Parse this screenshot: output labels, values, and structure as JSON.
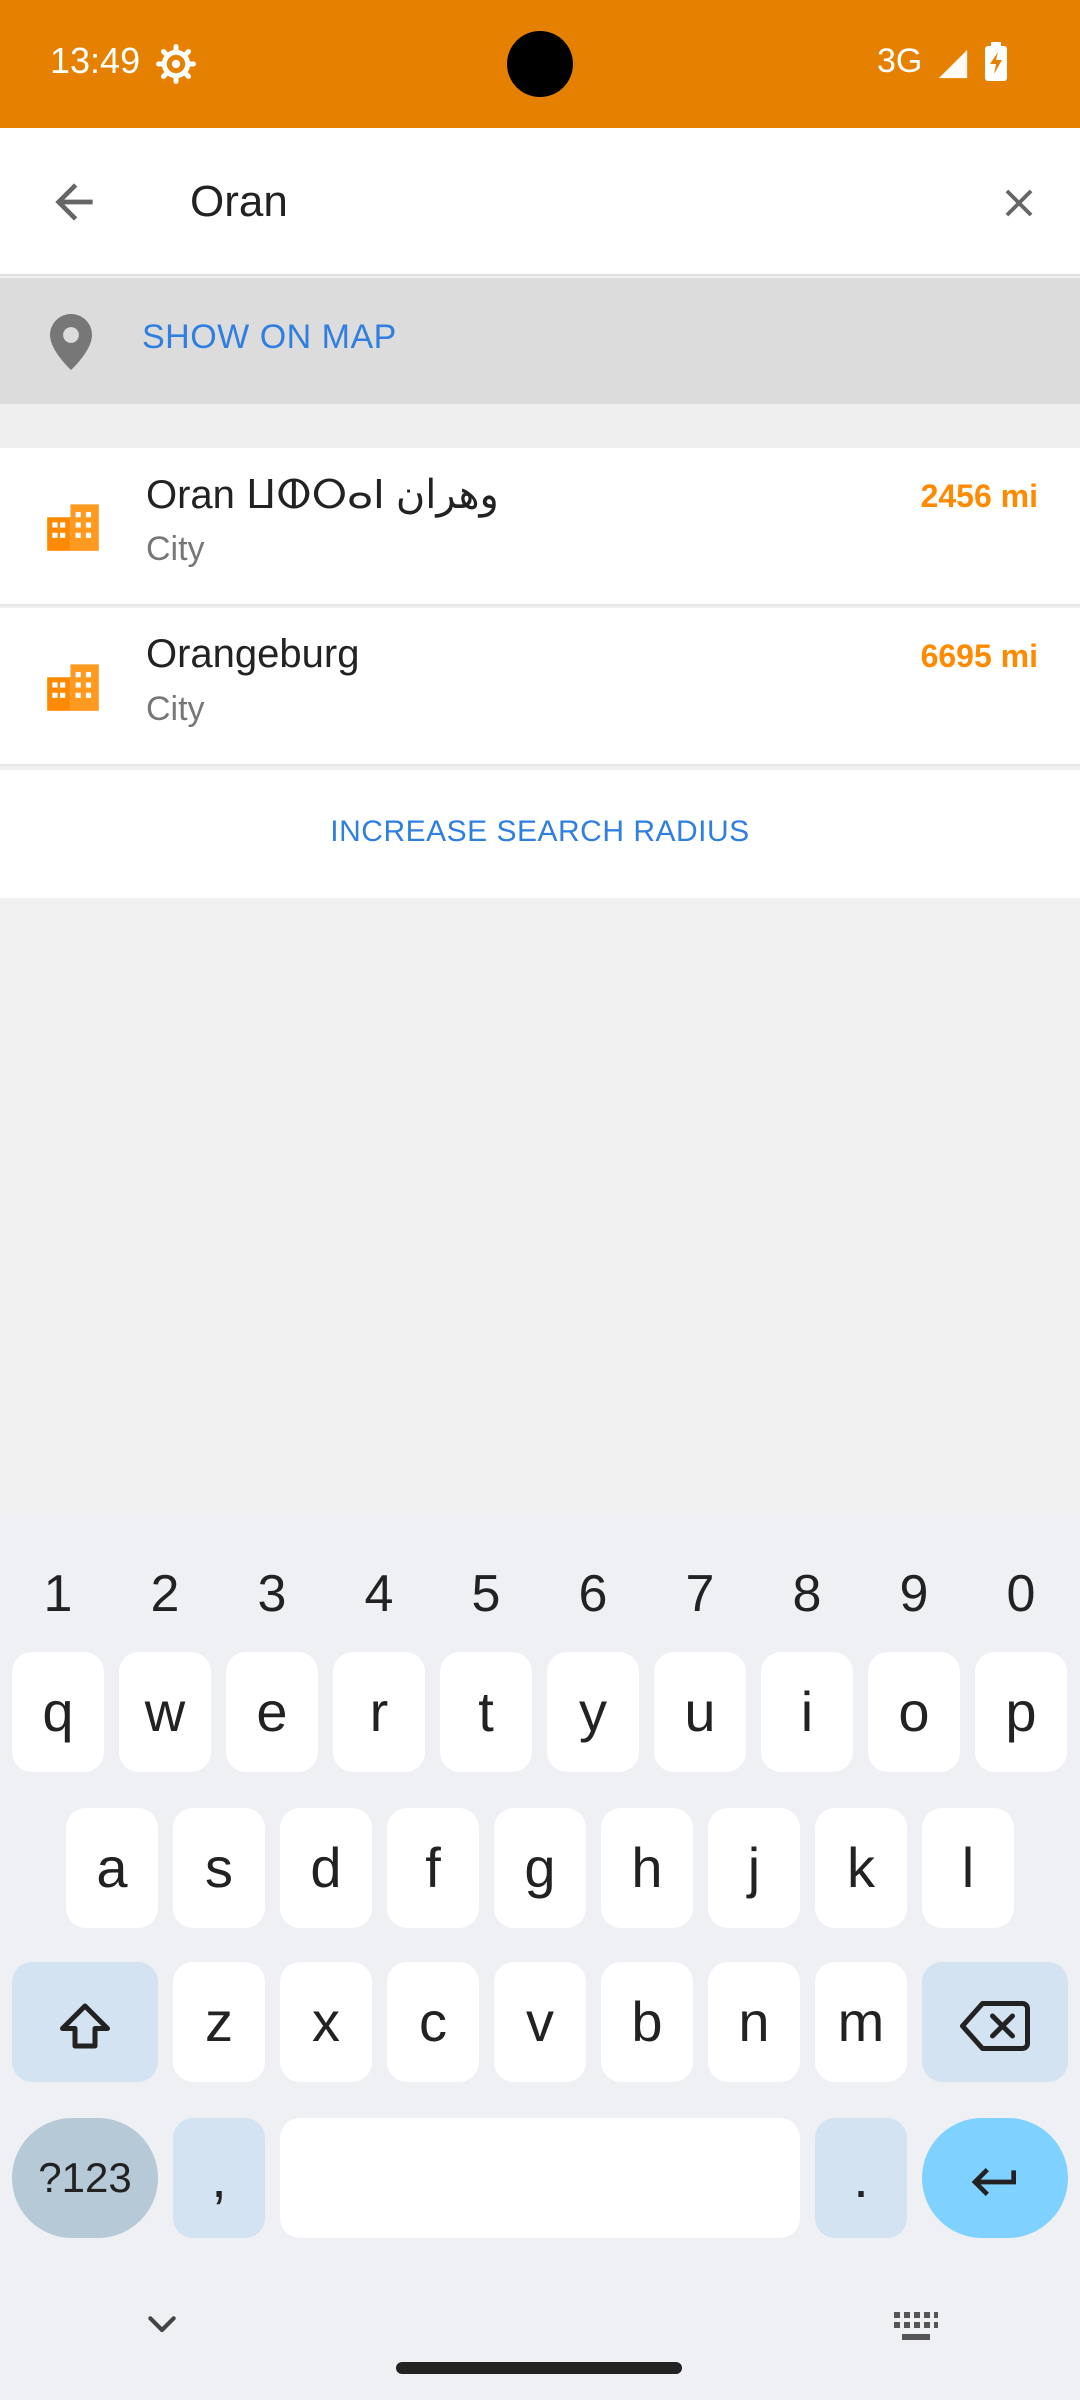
{
  "status_bar": {
    "time": "13:49",
    "network": "3G",
    "icons": [
      "settings-gear-icon",
      "signal-icon",
      "battery-charging-icon"
    ]
  },
  "search": {
    "query": "Oran",
    "back_icon": "arrow-back-icon",
    "clear_icon": "close-icon"
  },
  "show_on_map": {
    "label": "SHOW ON MAP",
    "icon": "map-pin-icon"
  },
  "results": [
    {
      "name": "Oran ⵡⵀⵔⴰⵏ وهران",
      "distance": "2456 mi",
      "type": "City",
      "icon": "city-icon"
    },
    {
      "name": "Orangeburg",
      "distance": "6695 mi",
      "type": "City",
      "icon": "city-icon"
    }
  ],
  "increase_radius": {
    "label": "INCREASE SEARCH RADIUS"
  },
  "keyboard": {
    "numbers": [
      "1",
      "2",
      "3",
      "4",
      "5",
      "6",
      "7",
      "8",
      "9",
      "0"
    ],
    "row1": [
      "q",
      "w",
      "e",
      "r",
      "t",
      "y",
      "u",
      "i",
      "o",
      "p"
    ],
    "row2": [
      "a",
      "s",
      "d",
      "f",
      "g",
      "h",
      "j",
      "k",
      "l"
    ],
    "row3": [
      "z",
      "x",
      "c",
      "v",
      "b",
      "n",
      "m"
    ],
    "symbols_key": "?123",
    "comma_key": ",",
    "period_key": "."
  },
  "colors": {
    "status_bar": "#e68000",
    "accent_blue": "#2f7fe0",
    "distance_orange": "#ff8a00",
    "enter_key": "#7fd2ff"
  }
}
